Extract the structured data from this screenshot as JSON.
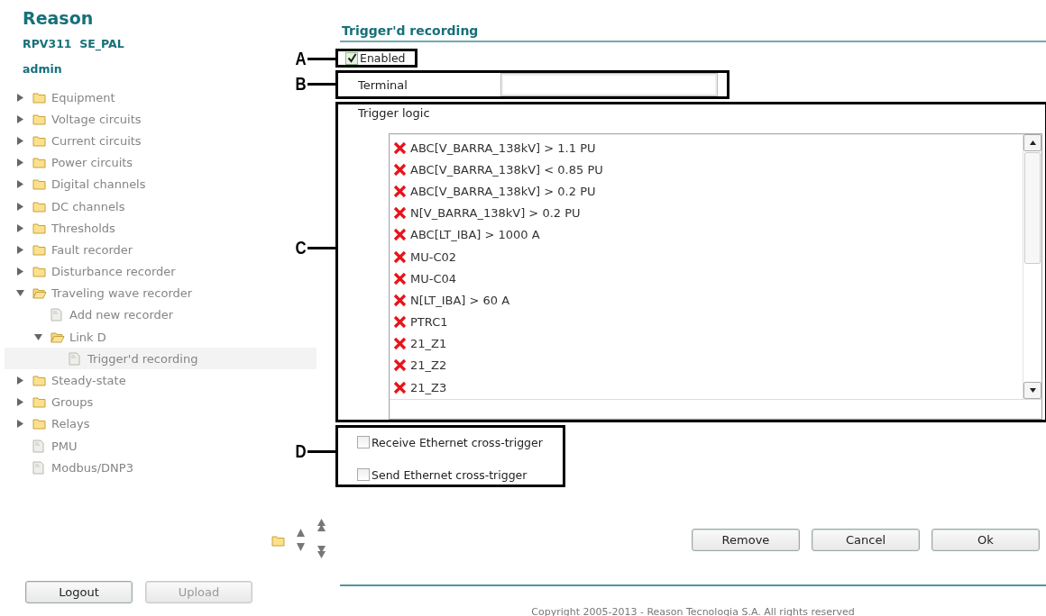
{
  "sidebar": {
    "brand": "Reason",
    "device": "RPV311  SE_PAL",
    "user": "admin",
    "tree": [
      {
        "label": "Equipment",
        "kind": "folder",
        "expanded": false,
        "selected": false
      },
      {
        "label": "Voltage circuits",
        "kind": "folder",
        "expanded": false,
        "selected": false
      },
      {
        "label": "Current circuits",
        "kind": "folder",
        "expanded": false,
        "selected": false
      },
      {
        "label": "Power circuits",
        "kind": "folder",
        "expanded": false,
        "selected": false
      },
      {
        "label": "Digital channels",
        "kind": "folder",
        "expanded": false,
        "selected": false
      },
      {
        "label": "DC channels",
        "kind": "folder",
        "expanded": false,
        "selected": false
      },
      {
        "label": "Thresholds",
        "kind": "folder",
        "expanded": false,
        "selected": false
      },
      {
        "label": "Fault recorder",
        "kind": "folder",
        "expanded": false,
        "selected": false
      },
      {
        "label": "Disturbance recorder",
        "kind": "folder",
        "expanded": false,
        "selected": false
      },
      {
        "label": "Traveling wave recorder",
        "kind": "folder",
        "expanded": true,
        "selected": false,
        "children": [
          {
            "label": "Add new recorder",
            "kind": "page",
            "selected": false
          },
          {
            "label": "Link D",
            "kind": "folder",
            "expanded": true,
            "selected": false,
            "children": [
              {
                "label": "Trigger'd recording",
                "kind": "page",
                "selected": true
              }
            ]
          }
        ]
      },
      {
        "label": "Steady-state",
        "kind": "folder",
        "expanded": false,
        "selected": false
      },
      {
        "label": "Groups",
        "kind": "folder",
        "expanded": false,
        "selected": false
      },
      {
        "label": "Relays",
        "kind": "folder",
        "expanded": false,
        "selected": false
      },
      {
        "label": "PMU",
        "kind": "page",
        "selected": false
      },
      {
        "label": "Modbus/DNP3",
        "kind": "page",
        "selected": false
      }
    ],
    "buttons": [
      {
        "label": "Logout",
        "disabled": false
      },
      {
        "label": "Upload",
        "disabled": true
      }
    ]
  },
  "page": {
    "title": "Trigger'd recording",
    "enabled": {
      "label": "Enabled",
      "checked": true
    },
    "terminal": {
      "label": "Terminal"
    },
    "trigger_logic": {
      "label": "Trigger logic",
      "items": [
        "ABC[V_BARRA_138kV] > 1.1 PU",
        "ABC[V_BARRA_138kV] < 0.85 PU",
        "ABC[V_BARRA_138kV] > 0.2 PU",
        "N[V_BARRA_138kV] > 0.2 PU",
        "ABC[LT_IBA] > 1000 A",
        "MU-C02",
        "MU-C04",
        "N[LT_IBA] > 60 A",
        "PTRC1",
        "21_Z1",
        "21_Z2",
        "21_Z3"
      ]
    },
    "cross_triggers": [
      {
        "label": "Receive Ethernet cross-trigger",
        "checked": false
      },
      {
        "label": "Send Ethernet cross-trigger",
        "checked": false
      }
    ],
    "buttons": [
      "Remove",
      "Cancel",
      "Ok"
    ],
    "copyright": "Copyright 2005-2013 - Reason Tecnologia S.A. All rights reserved"
  },
  "callouts": [
    "A",
    "B",
    "C",
    "D"
  ]
}
